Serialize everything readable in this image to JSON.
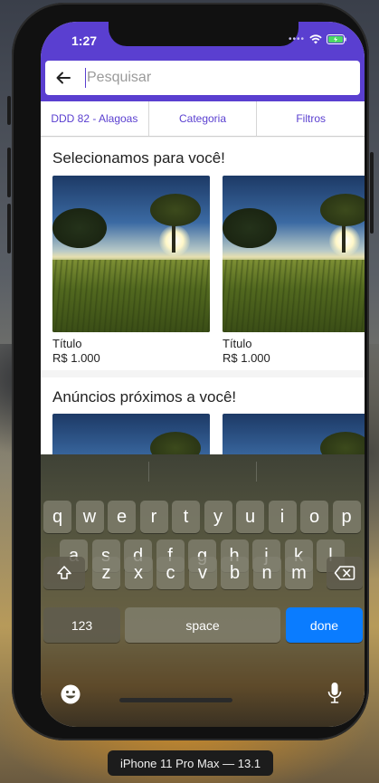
{
  "status": {
    "time": "1:27"
  },
  "search": {
    "placeholder": "Pesquisar"
  },
  "filters": [
    {
      "label": "DDD 82 - Alagoas"
    },
    {
      "label": "Categoria"
    },
    {
      "label": "Filtros"
    }
  ],
  "sections": [
    {
      "title": "Selecionamos para você!",
      "cards": [
        {
          "title": "Título",
          "price": "R$ 1.000"
        },
        {
          "title": "Título",
          "price": "R$ 1.000"
        }
      ]
    },
    {
      "title": "Anúncios próximos a você!"
    }
  ],
  "keyboard": {
    "row1": [
      "q",
      "w",
      "e",
      "r",
      "t",
      "y",
      "u",
      "i",
      "o",
      "p"
    ],
    "row2": [
      "a",
      "s",
      "d",
      "f",
      "g",
      "h",
      "j",
      "k",
      "l"
    ],
    "row3": [
      "z",
      "x",
      "c",
      "v",
      "b",
      "n",
      "m"
    ],
    "numbers_label": "123",
    "space_label": "space",
    "done_label": "done"
  },
  "device_caption": "iPhone 11 Pro Max — 13.1",
  "colors": {
    "primary": "#5a3fd0",
    "done_key": "#0a7cff"
  },
  "icons": [
    "back-arrow-icon",
    "wifi-icon",
    "battery-icon",
    "shift-icon",
    "backspace-icon",
    "emoji-icon",
    "microphone-icon"
  ]
}
